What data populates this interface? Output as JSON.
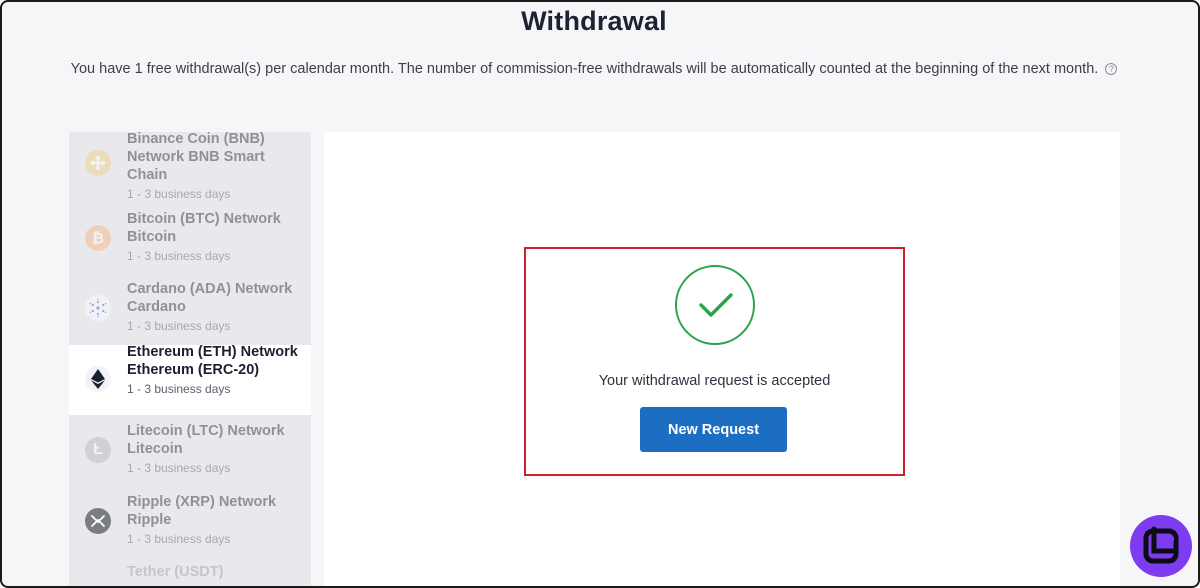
{
  "page": {
    "title": "Withdrawal",
    "notice": "You have 1 free withdrawal(s) per calendar month. The number of commission-free withdrawals will be automatically counted at the beginning of the next month."
  },
  "methods": [
    {
      "name": "Binance Coin (BNB) Network BNB Smart Chain",
      "days": "1 - 3 business days",
      "icon": "bnb-icon",
      "color": "#f3ba2f"
    },
    {
      "name": "Bitcoin (BTC) Network Bitcoin",
      "days": "1 - 3 business days",
      "icon": "bitcoin-icon",
      "color": "#f7931a"
    },
    {
      "name": "Cardano (ADA) Network Cardano",
      "days": "1 - 3 business days",
      "icon": "cardano-icon",
      "color": "#2a5bd7"
    },
    {
      "name": "Ethereum (ETH) Network Ethereum (ERC-20)",
      "days": "1 - 3 business days",
      "icon": "ethereum-icon",
      "color": "#1b2130",
      "selected": true
    },
    {
      "name": "Litecoin (LTC) Network Litecoin",
      "days": "1 - 3 business days",
      "icon": "litecoin-icon",
      "color": "#8c8c8c"
    },
    {
      "name": "Ripple (XRP) Network Ripple",
      "days": "1 - 3 business days",
      "icon": "ripple-icon",
      "color": "#555a63"
    },
    {
      "name": "Tether (USDT)",
      "days": "",
      "icon": "tether-icon",
      "color": "#26a17b"
    }
  ],
  "result": {
    "message": "Your withdrawal request is accepted",
    "button_label": "New Request",
    "status_color": "#2aa44a"
  },
  "colors": {
    "accent": "#1b6ec2",
    "highlight_border": "#d0202b",
    "brand": "#7d3cf0"
  }
}
